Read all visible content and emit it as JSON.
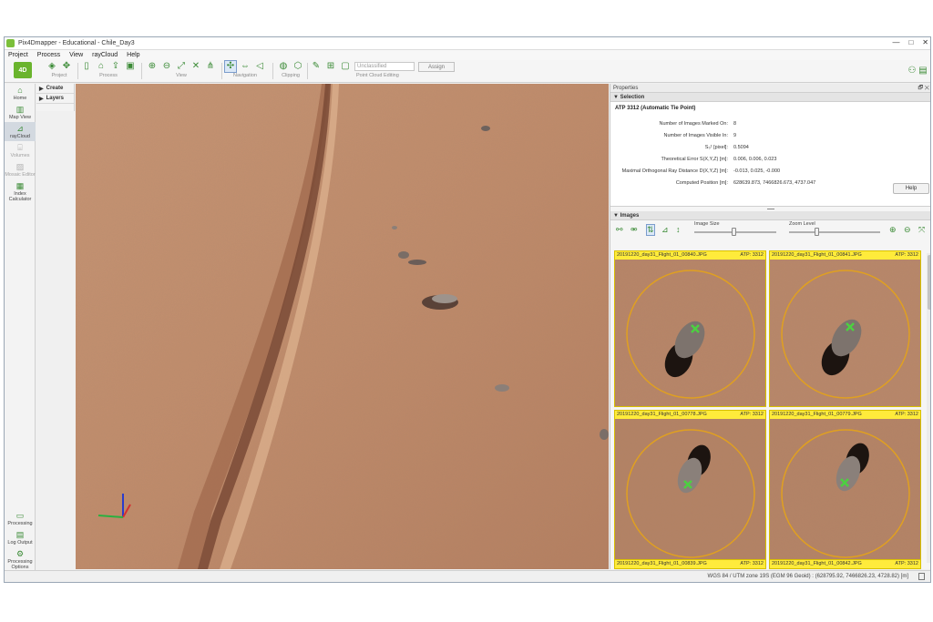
{
  "window": {
    "title": "Pix4Dmapper - Educational - Chile_Day3",
    "minimize": "—",
    "maximize": "□",
    "close": "✕"
  },
  "menu": [
    "Project",
    "Process",
    "View",
    "rayCloud",
    "Help"
  ],
  "toolbar": {
    "logo_text": "4D",
    "groups": {
      "project": "Project",
      "process": "Process",
      "view": "View",
      "navigation": "Navigation",
      "clipping": "Clipping",
      "point_cloud_editing": "Point Cloud Editing"
    },
    "classification_select": "Unclassified",
    "assign_button": "Assign",
    "icons": {
      "project": [
        "layers-icon",
        "move-icon"
      ],
      "process": [
        "document-icon",
        "bag-icon",
        "export-icon"
      ],
      "view": [
        "zoom-in-icon",
        "zoom-out-icon",
        "fit-icon",
        "collapse-icon",
        "tree-icon"
      ],
      "navigation": [
        "navigate-icon",
        "pan-icon",
        "fly-icon"
      ],
      "clipping": [
        "clip-sphere-icon",
        "clip-box-icon"
      ],
      "editing": [
        "brush-icon",
        "select-add-icon",
        "select-box-icon"
      ]
    }
  },
  "sidebar": {
    "items": [
      {
        "label": "Home",
        "icon": "home-icon",
        "state": "normal"
      },
      {
        "label": "Map View",
        "icon": "map-icon",
        "state": "normal"
      },
      {
        "label": "rayCloud",
        "icon": "raycloud-icon",
        "state": "active"
      },
      {
        "label": "Volumes",
        "icon": "volumes-icon",
        "state": "disabled"
      },
      {
        "label": "Mosaic Editor",
        "icon": "mosaic-icon",
        "state": "disabled"
      },
      {
        "label": "Index Calculator",
        "icon": "index-icon",
        "state": "normal"
      }
    ],
    "bottom_items": [
      {
        "label": "Processing",
        "icon": "processing-icon"
      },
      {
        "label": "Log Output",
        "icon": "log-icon"
      },
      {
        "label": "Processing Options",
        "icon": "gear-icon"
      }
    ]
  },
  "layers_panel": {
    "create": "Create",
    "layers": "Layers"
  },
  "properties": {
    "header": "Properties",
    "header_controls": "🗗 ✕",
    "selection_title": "Selection",
    "atp_title": "ATP 3312 (Automatic Tie Point)",
    "rows": [
      {
        "label": "Number of Images Marked On:",
        "value": "8"
      },
      {
        "label": "Number of Images Visible In:",
        "value": "9"
      },
      {
        "label": "S₀¹ [pixel]:",
        "value": "0.5094"
      },
      {
        "label": "Theoretical Error S(X,Y,Z) [m]:",
        "value": "0.006, 0.006, 0.023"
      },
      {
        "label": "Maximal Orthogonal Ray Distance D(X,Y,Z) [m]:",
        "value": "-0.013, 0.025, -0.000"
      },
      {
        "label": "Computed Position [m]:",
        "value": "628639.873, 7466826.673, 4737.047"
      }
    ],
    "help_button": "Help",
    "images_title": "Images",
    "image_size_label": "Image Size",
    "zoom_level_label": "Zoom Level",
    "image_size_level": 0.48,
    "zoom_level": 0.3
  },
  "thumbnails": [
    {
      "filename": "20191220_day31_Flight_01_00840.JPG",
      "atp": "ATP: 3312"
    },
    {
      "filename": "20191220_day31_Flight_01_00841.JPG",
      "atp": "ATP: 3312"
    },
    {
      "filename": "20191220_day31_Flight_01_00778.JPG",
      "atp": "ATP: 3312"
    },
    {
      "filename": "20191220_day31_Flight_01_00779.JPG",
      "atp": "ATP: 3312"
    },
    {
      "filename": "20191220_day31_Flight_01_00839.JPG",
      "atp": "ATP: 3312"
    },
    {
      "filename": "20191220_day31_Flight_01_00842.JPG",
      "atp": "ATP: 3312"
    }
  ],
  "status": {
    "text": "WGS 84 / UTM zone 19S (EGM 96 Geoid) : (628795.92, 7466826.23, 4728.82) [m]"
  },
  "colors": {
    "accent_green": "#3a8a35",
    "ground": "#c08b6a",
    "thumb_bar": "#ffeb3b",
    "circle": "#e0a020",
    "marker": "#4cd040"
  }
}
